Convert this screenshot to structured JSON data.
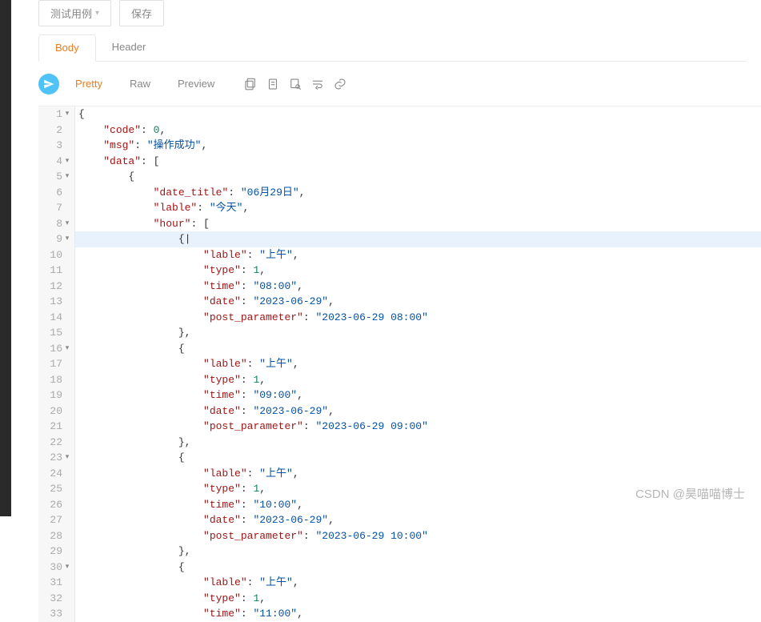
{
  "toolbar": {
    "test_case_label": "测试用例",
    "save_label": "保存"
  },
  "tabs": {
    "body": "Body",
    "header": "Header"
  },
  "view_tabs": {
    "pretty": "Pretty",
    "raw": "Raw",
    "preview": "Preview"
  },
  "watermark": "CSDN @昊喵喵博士",
  "code_lines": [
    {
      "n": 1,
      "fold": true,
      "indent": 0,
      "tokens": [
        [
          "punc",
          "{"
        ]
      ]
    },
    {
      "n": 2,
      "indent": 1,
      "tokens": [
        [
          "key",
          "\"code\""
        ],
        [
          "punc",
          ": "
        ],
        [
          "num",
          "0"
        ],
        [
          "punc",
          ","
        ]
      ]
    },
    {
      "n": 3,
      "indent": 1,
      "tokens": [
        [
          "key",
          "\"msg\""
        ],
        [
          "punc",
          ": "
        ],
        [
          "str",
          "\"操作成功\""
        ],
        [
          "punc",
          ","
        ]
      ]
    },
    {
      "n": 4,
      "fold": true,
      "indent": 1,
      "tokens": [
        [
          "key",
          "\"data\""
        ],
        [
          "punc",
          ": ["
        ]
      ]
    },
    {
      "n": 5,
      "fold": true,
      "indent": 2,
      "tokens": [
        [
          "punc",
          "{"
        ]
      ]
    },
    {
      "n": 6,
      "indent": 3,
      "tokens": [
        [
          "key",
          "\"date_title\""
        ],
        [
          "punc",
          ": "
        ],
        [
          "str",
          "\"06月29日\""
        ],
        [
          "punc",
          ","
        ]
      ]
    },
    {
      "n": 7,
      "indent": 3,
      "tokens": [
        [
          "key",
          "\"lable\""
        ],
        [
          "punc",
          ": "
        ],
        [
          "str",
          "\"今天\""
        ],
        [
          "punc",
          ","
        ]
      ]
    },
    {
      "n": 8,
      "fold": true,
      "indent": 3,
      "tokens": [
        [
          "key",
          "\"hour\""
        ],
        [
          "punc",
          ": ["
        ]
      ]
    },
    {
      "n": 9,
      "fold": true,
      "highlighted": true,
      "indent": 4,
      "tokens": [
        [
          "punc",
          "{"
        ],
        [
          "cursor",
          "|"
        ]
      ]
    },
    {
      "n": 10,
      "indent": 5,
      "tokens": [
        [
          "key",
          "\"lable\""
        ],
        [
          "punc",
          ": "
        ],
        [
          "str",
          "\"上午\""
        ],
        [
          "punc",
          ","
        ]
      ]
    },
    {
      "n": 11,
      "indent": 5,
      "tokens": [
        [
          "key",
          "\"type\""
        ],
        [
          "punc",
          ": "
        ],
        [
          "num",
          "1"
        ],
        [
          "punc",
          ","
        ]
      ]
    },
    {
      "n": 12,
      "indent": 5,
      "tokens": [
        [
          "key",
          "\"time\""
        ],
        [
          "punc",
          ": "
        ],
        [
          "str",
          "\"08:00\""
        ],
        [
          "punc",
          ","
        ]
      ]
    },
    {
      "n": 13,
      "indent": 5,
      "tokens": [
        [
          "key",
          "\"date\""
        ],
        [
          "punc",
          ": "
        ],
        [
          "str",
          "\"2023-06-29\""
        ],
        [
          "punc",
          ","
        ]
      ]
    },
    {
      "n": 14,
      "indent": 5,
      "tokens": [
        [
          "key",
          "\"post_parameter\""
        ],
        [
          "punc",
          ": "
        ],
        [
          "str",
          "\"2023-06-29 08:00\""
        ]
      ]
    },
    {
      "n": 15,
      "indent": 4,
      "tokens": [
        [
          "punc",
          "},"
        ]
      ]
    },
    {
      "n": 16,
      "fold": true,
      "indent": 4,
      "tokens": [
        [
          "punc",
          "{"
        ]
      ]
    },
    {
      "n": 17,
      "indent": 5,
      "tokens": [
        [
          "key",
          "\"lable\""
        ],
        [
          "punc",
          ": "
        ],
        [
          "str",
          "\"上午\""
        ],
        [
          "punc",
          ","
        ]
      ]
    },
    {
      "n": 18,
      "indent": 5,
      "tokens": [
        [
          "key",
          "\"type\""
        ],
        [
          "punc",
          ": "
        ],
        [
          "num",
          "1"
        ],
        [
          "punc",
          ","
        ]
      ]
    },
    {
      "n": 19,
      "indent": 5,
      "tokens": [
        [
          "key",
          "\"time\""
        ],
        [
          "punc",
          ": "
        ],
        [
          "str",
          "\"09:00\""
        ],
        [
          "punc",
          ","
        ]
      ]
    },
    {
      "n": 20,
      "indent": 5,
      "tokens": [
        [
          "key",
          "\"date\""
        ],
        [
          "punc",
          ": "
        ],
        [
          "str",
          "\"2023-06-29\""
        ],
        [
          "punc",
          ","
        ]
      ]
    },
    {
      "n": 21,
      "indent": 5,
      "tokens": [
        [
          "key",
          "\"post_parameter\""
        ],
        [
          "punc",
          ": "
        ],
        [
          "str",
          "\"2023-06-29 09:00\""
        ]
      ]
    },
    {
      "n": 22,
      "indent": 4,
      "tokens": [
        [
          "punc",
          "},"
        ]
      ]
    },
    {
      "n": 23,
      "fold": true,
      "indent": 4,
      "tokens": [
        [
          "punc",
          "{"
        ]
      ]
    },
    {
      "n": 24,
      "indent": 5,
      "tokens": [
        [
          "key",
          "\"lable\""
        ],
        [
          "punc",
          ": "
        ],
        [
          "str",
          "\"上午\""
        ],
        [
          "punc",
          ","
        ]
      ]
    },
    {
      "n": 25,
      "indent": 5,
      "tokens": [
        [
          "key",
          "\"type\""
        ],
        [
          "punc",
          ": "
        ],
        [
          "num",
          "1"
        ],
        [
          "punc",
          ","
        ]
      ]
    },
    {
      "n": 26,
      "indent": 5,
      "tokens": [
        [
          "key",
          "\"time\""
        ],
        [
          "punc",
          ": "
        ],
        [
          "str",
          "\"10:00\""
        ],
        [
          "punc",
          ","
        ]
      ]
    },
    {
      "n": 27,
      "indent": 5,
      "tokens": [
        [
          "key",
          "\"date\""
        ],
        [
          "punc",
          ": "
        ],
        [
          "str",
          "\"2023-06-29\""
        ],
        [
          "punc",
          ","
        ]
      ]
    },
    {
      "n": 28,
      "indent": 5,
      "tokens": [
        [
          "key",
          "\"post_parameter\""
        ],
        [
          "punc",
          ": "
        ],
        [
          "str",
          "\"2023-06-29 10:00\""
        ]
      ]
    },
    {
      "n": 29,
      "indent": 4,
      "tokens": [
        [
          "punc",
          "},"
        ]
      ]
    },
    {
      "n": 30,
      "fold": true,
      "indent": 4,
      "tokens": [
        [
          "punc",
          "{"
        ]
      ]
    },
    {
      "n": 31,
      "indent": 5,
      "tokens": [
        [
          "key",
          "\"lable\""
        ],
        [
          "punc",
          ": "
        ],
        [
          "str",
          "\"上午\""
        ],
        [
          "punc",
          ","
        ]
      ]
    },
    {
      "n": 32,
      "indent": 5,
      "tokens": [
        [
          "key",
          "\"type\""
        ],
        [
          "punc",
          ": "
        ],
        [
          "num",
          "1"
        ],
        [
          "punc",
          ","
        ]
      ]
    },
    {
      "n": 33,
      "indent": 5,
      "tokens": [
        [
          "key",
          "\"time\""
        ],
        [
          "punc",
          ": "
        ],
        [
          "str",
          "\"11:00\""
        ],
        [
          "punc",
          ","
        ]
      ]
    }
  ]
}
